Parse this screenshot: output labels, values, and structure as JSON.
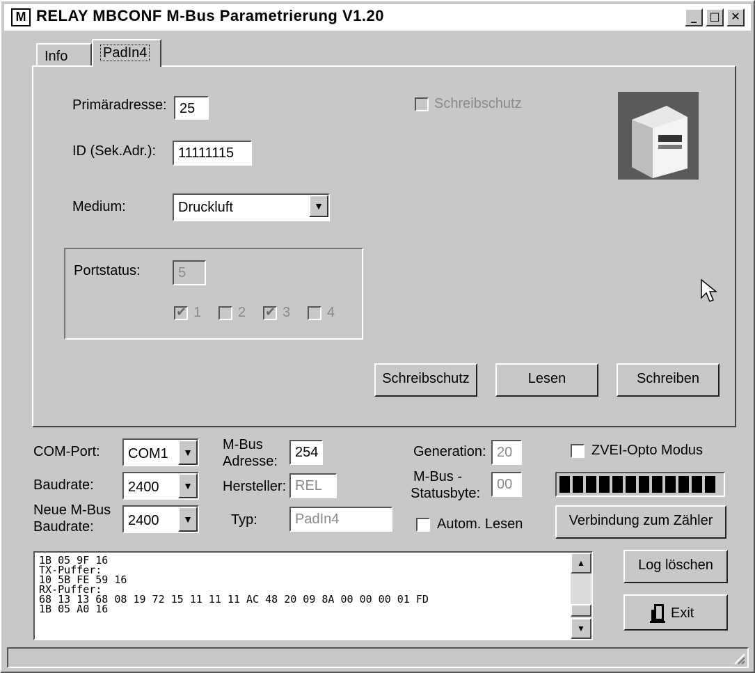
{
  "window": {
    "title": "RELAY MBCONF  M-Bus Parametrierung  V1.20",
    "icon": "app-logo-icon"
  },
  "tabs": [
    {
      "label": "Info"
    },
    {
      "label": "PadIn4"
    }
  ],
  "device": {
    "primary_label": "Primäradresse:",
    "primary_value": "25",
    "id_label": "ID (Sek.Adr.):",
    "id_value": "11111115",
    "medium_label": "Medium:",
    "medium_value": "Druckluft",
    "write_protect_label": "Schreibschutz",
    "portstatus_label": "Portstatus:",
    "portstatus_value": "5",
    "ports": [
      {
        "label": "1",
        "checked": true
      },
      {
        "label": "2",
        "checked": false
      },
      {
        "label": "3",
        "checked": true
      },
      {
        "label": "4",
        "checked": false
      }
    ],
    "buttons": {
      "schreibschutz": "Schreibschutz",
      "lesen": "Lesen",
      "schreiben": "Schreiben"
    }
  },
  "comm": {
    "com_port_label": "COM-Port:",
    "com_port_value": "COM1",
    "baudrate_label": "Baudrate:",
    "baudrate_value": "2400",
    "new_baud_label_1": "Neue M-Bus",
    "new_baud_label_2": "Baudrate:",
    "new_baud_value": "2400",
    "mbus_addr_label_1": "M-Bus",
    "mbus_addr_label_2": "Adresse:",
    "mbus_addr_value": "254",
    "hersteller_label": "Hersteller:",
    "hersteller_value": "REL",
    "typ_label": "Typ:",
    "typ_value": "PadIn4",
    "generation_label": "Generation:",
    "generation_value": "20",
    "status_label_1": "M-Bus -",
    "status_label_2": "Statusbyte:",
    "status_value": "00",
    "autom_lesen_label": "Autom. Lesen",
    "zvei_label": "ZVEI-Opto Modus",
    "connect_button": "Verbindung zum Zähler",
    "progress_blocks": 12
  },
  "log": {
    "lines": [
      "1B 05 9F 16",
      "TX-Puffer:",
      "10 5B FE 59 16",
      "RX-Puffer:",
      "68 13 13 68 08 19 72 15 11 11 11 AC 48 20 09 8A 00 00 00 01 FD",
      "1B 05 A0 16"
    ],
    "clear_button": "Log löschen",
    "exit_button": "Exit"
  },
  "colors": {
    "face": "#c8c8c8",
    "disabled_text": "#8a8a8a",
    "progress": "#000000"
  }
}
